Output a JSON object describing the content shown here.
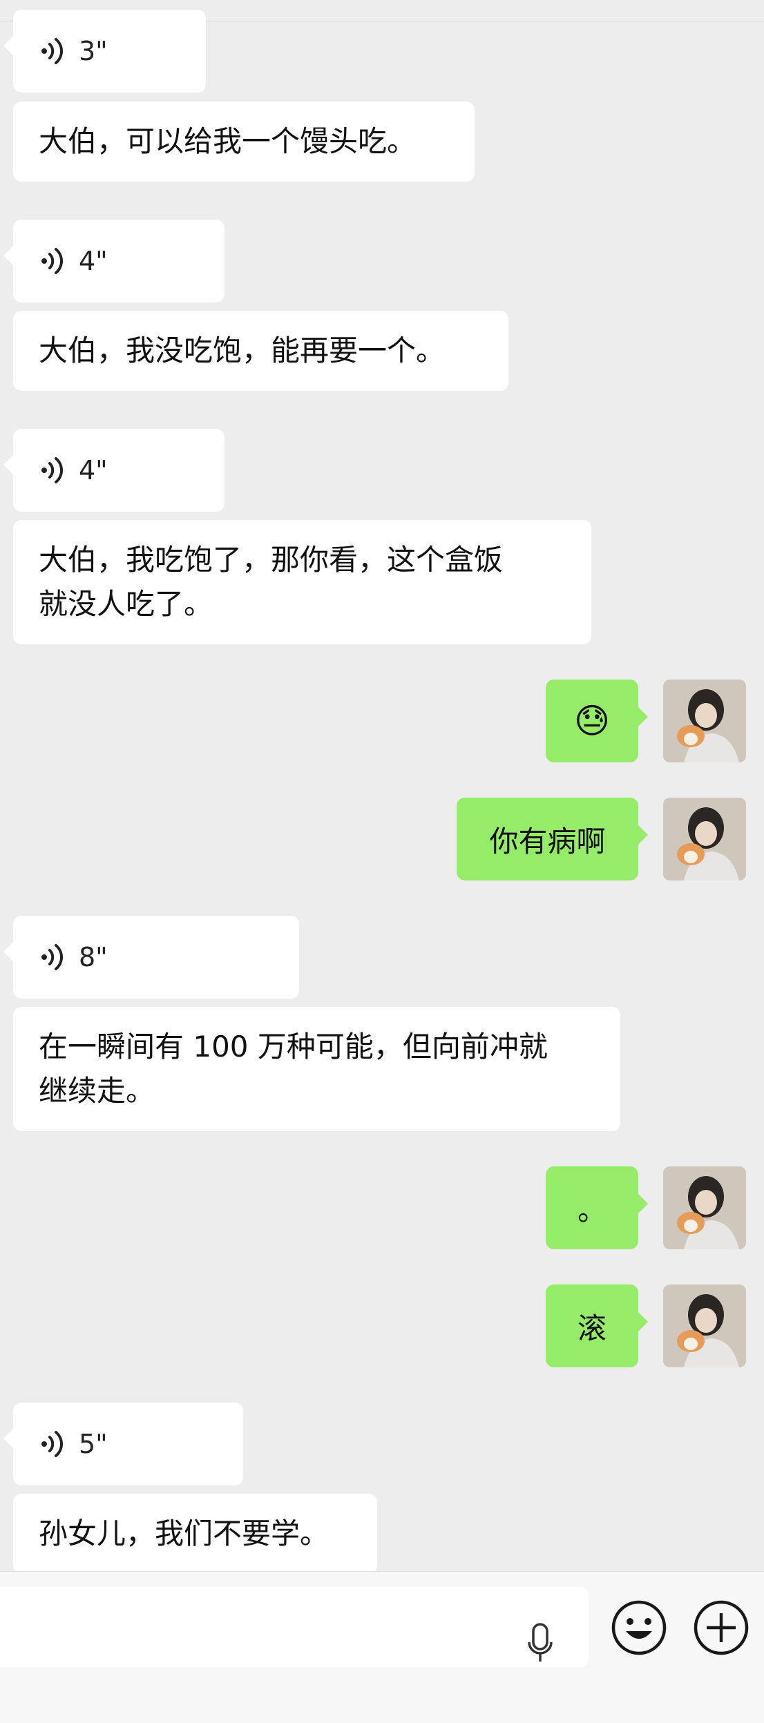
{
  "messages": [
    {
      "side": "left",
      "type": "voice",
      "duration": "3\""
    },
    {
      "side": "left",
      "type": "text",
      "text": "大伯，可以给我一个馒头吃。"
    },
    {
      "side": "left",
      "type": "voice",
      "duration": "4\""
    },
    {
      "side": "left",
      "type": "text",
      "text": "大伯，我没吃饱，能再要一个。"
    },
    {
      "side": "left",
      "type": "voice",
      "duration": "4\""
    },
    {
      "side": "left",
      "type": "text",
      "lines": [
        "大伯，我吃饱了，那你看，这个盒饭",
        "就没人吃了。"
      ]
    },
    {
      "side": "right",
      "type": "emoji",
      "emoji": "😓"
    },
    {
      "side": "right",
      "type": "text",
      "text": "你有病啊"
    },
    {
      "side": "left",
      "type": "voice",
      "duration": "8\""
    },
    {
      "side": "left",
      "type": "text",
      "lines": [
        "在一瞬间有 100 万种可能，但向前冲就",
        "继续走。"
      ]
    },
    {
      "side": "right",
      "type": "text",
      "text": "。"
    },
    {
      "side": "right",
      "type": "text",
      "text": "滚"
    },
    {
      "side": "left",
      "type": "voice",
      "duration": "5\""
    },
    {
      "side": "left",
      "type": "text",
      "text": "孙女儿，我们不要学。"
    }
  ],
  "input": {
    "value": "",
    "placeholder": ""
  },
  "icons": {
    "voice": "voice-wave-icon",
    "mic": "microphone-icon",
    "emoji": "smiley-face-icon",
    "plus": "plus-circle-icon"
  },
  "colors": {
    "background": "#ededed",
    "left_bubble": "#ffffff",
    "right_bubble": "#95ec69"
  }
}
